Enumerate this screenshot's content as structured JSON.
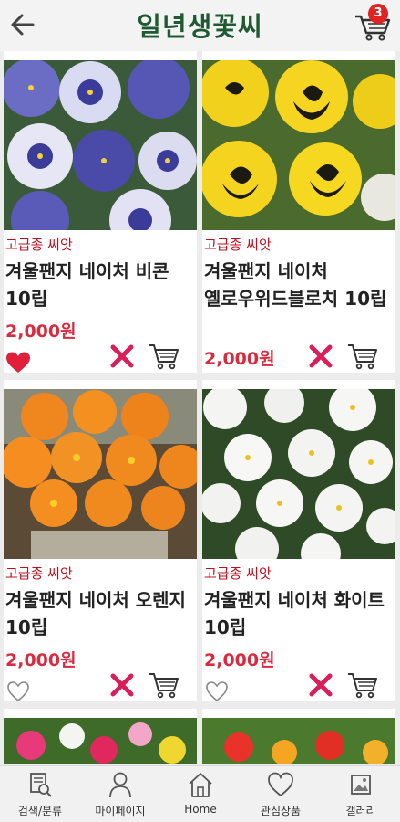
{
  "header": {
    "title": "일년생꽃씨",
    "cart_count": "3"
  },
  "products": [
    {
      "tag": "고급종 씨앗",
      "name": "겨울팬지 네이처 비콘 10립",
      "price": "2,000원",
      "liked": true,
      "image": "blue-white-pansy-photo"
    },
    {
      "tag": "고급종 씨앗",
      "name": "겨울팬지 네이처 옐로우위드블로치 10립",
      "price": "2,000원",
      "liked": false,
      "image": "yellow-blotch-pansy-photo"
    },
    {
      "tag": "고급종 씨앗",
      "name": "겨울팬지 네이처 오렌지 10립",
      "price": "2,000원",
      "liked": false,
      "image": "orange-pansy-photo"
    },
    {
      "tag": "고급종 씨앗",
      "name": "겨울팬지 네이처 화이트 10립",
      "price": "2,000원",
      "liked": false,
      "image": "white-pansy-photo"
    }
  ],
  "nav": [
    {
      "label": "검색/분류",
      "icon": "search-category-icon"
    },
    {
      "label": "마이페이지",
      "icon": "person-icon"
    },
    {
      "label": "Home",
      "icon": "home-icon"
    },
    {
      "label": "관심상품",
      "icon": "heart-icon"
    },
    {
      "label": "갤러리",
      "icon": "gallery-icon"
    }
  ],
  "colors": {
    "title": "#1f5a32",
    "tag": "#c0101e",
    "price": "#d82b3f",
    "remove": "#d91e5a",
    "badge": "#e02424"
  }
}
